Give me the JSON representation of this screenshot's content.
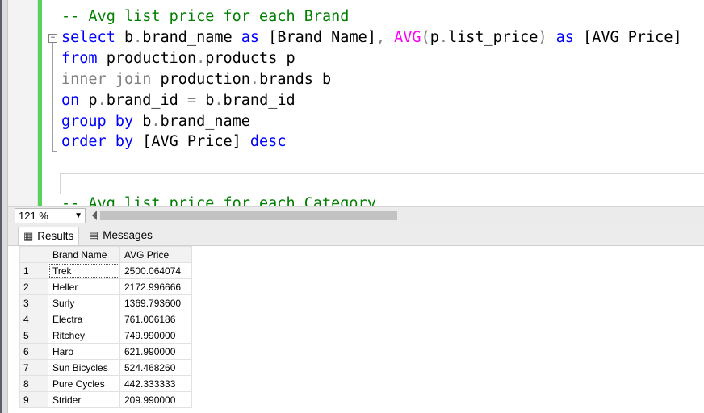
{
  "editor": {
    "lines": [
      {
        "parts": [
          {
            "t": "-- Avg list price for each Brand",
            "c": "cm"
          }
        ]
      },
      {
        "parts": [
          {
            "t": "select",
            "c": "kw"
          },
          {
            "t": " b",
            "c": ""
          },
          {
            "t": ".",
            "c": "gray"
          },
          {
            "t": "brand_name ",
            "c": ""
          },
          {
            "t": "as",
            "c": "kw"
          },
          {
            "t": " [Brand Name]",
            "c": ""
          },
          {
            "t": ", ",
            "c": "gray"
          },
          {
            "t": "AVG",
            "c": "fn"
          },
          {
            "t": "(",
            "c": "gray"
          },
          {
            "t": "p",
            "c": ""
          },
          {
            "t": ".",
            "c": "gray"
          },
          {
            "t": "list_price",
            "c": ""
          },
          {
            "t": ")",
            "c": "gray"
          },
          {
            "t": " ",
            "c": ""
          },
          {
            "t": "as",
            "c": "kw"
          },
          {
            "t": " [AVG Price]",
            "c": ""
          }
        ]
      },
      {
        "parts": [
          {
            "t": "from",
            "c": "kw"
          },
          {
            "t": " production",
            "c": ""
          },
          {
            "t": ".",
            "c": "gray"
          },
          {
            "t": "products p",
            "c": ""
          }
        ]
      },
      {
        "parts": [
          {
            "t": "inner join",
            "c": "gray"
          },
          {
            "t": " production",
            "c": ""
          },
          {
            "t": ".",
            "c": "gray"
          },
          {
            "t": "brands b",
            "c": ""
          }
        ]
      },
      {
        "parts": [
          {
            "t": "on",
            "c": "kw"
          },
          {
            "t": " p",
            "c": ""
          },
          {
            "t": ".",
            "c": "gray"
          },
          {
            "t": "brand_id ",
            "c": ""
          },
          {
            "t": "=",
            "c": "gray"
          },
          {
            "t": " b",
            "c": ""
          },
          {
            "t": ".",
            "c": "gray"
          },
          {
            "t": "brand_id",
            "c": ""
          }
        ]
      },
      {
        "parts": [
          {
            "t": "group by",
            "c": "kw"
          },
          {
            "t": " b",
            "c": ""
          },
          {
            "t": ".",
            "c": "gray"
          },
          {
            "t": "brand_name",
            "c": ""
          }
        ]
      },
      {
        "parts": [
          {
            "t": "order by",
            "c": "kw"
          },
          {
            "t": " [AVG Price] ",
            "c": ""
          },
          {
            "t": "desc",
            "c": "kw"
          }
        ]
      },
      {
        "parts": []
      },
      {
        "parts": []
      },
      {
        "parts": [
          {
            "t": "-- Avg list price for each Category",
            "c": "cm"
          }
        ]
      }
    ]
  },
  "zoom": {
    "value": "121 %"
  },
  "tabs": {
    "results": "Results",
    "messages": "Messages"
  },
  "grid": {
    "columns": [
      "Brand Name",
      "AVG Price"
    ],
    "rows": [
      {
        "n": "1",
        "brand": "Trek",
        "price": "2500.064074"
      },
      {
        "n": "2",
        "brand": "Heller",
        "price": "2172.996666"
      },
      {
        "n": "3",
        "brand": "Surly",
        "price": "1369.793600"
      },
      {
        "n": "4",
        "brand": "Electra",
        "price": "761.006186"
      },
      {
        "n": "5",
        "brand": "Ritchey",
        "price": "749.990000"
      },
      {
        "n": "6",
        "brand": "Haro",
        "price": "621.990000"
      },
      {
        "n": "7",
        "brand": "Sun Bicycles",
        "price": "524.468260"
      },
      {
        "n": "8",
        "brand": "Pure Cycles",
        "price": "442.333333"
      },
      {
        "n": "9",
        "brand": "Strider",
        "price": "209.990000"
      }
    ]
  }
}
